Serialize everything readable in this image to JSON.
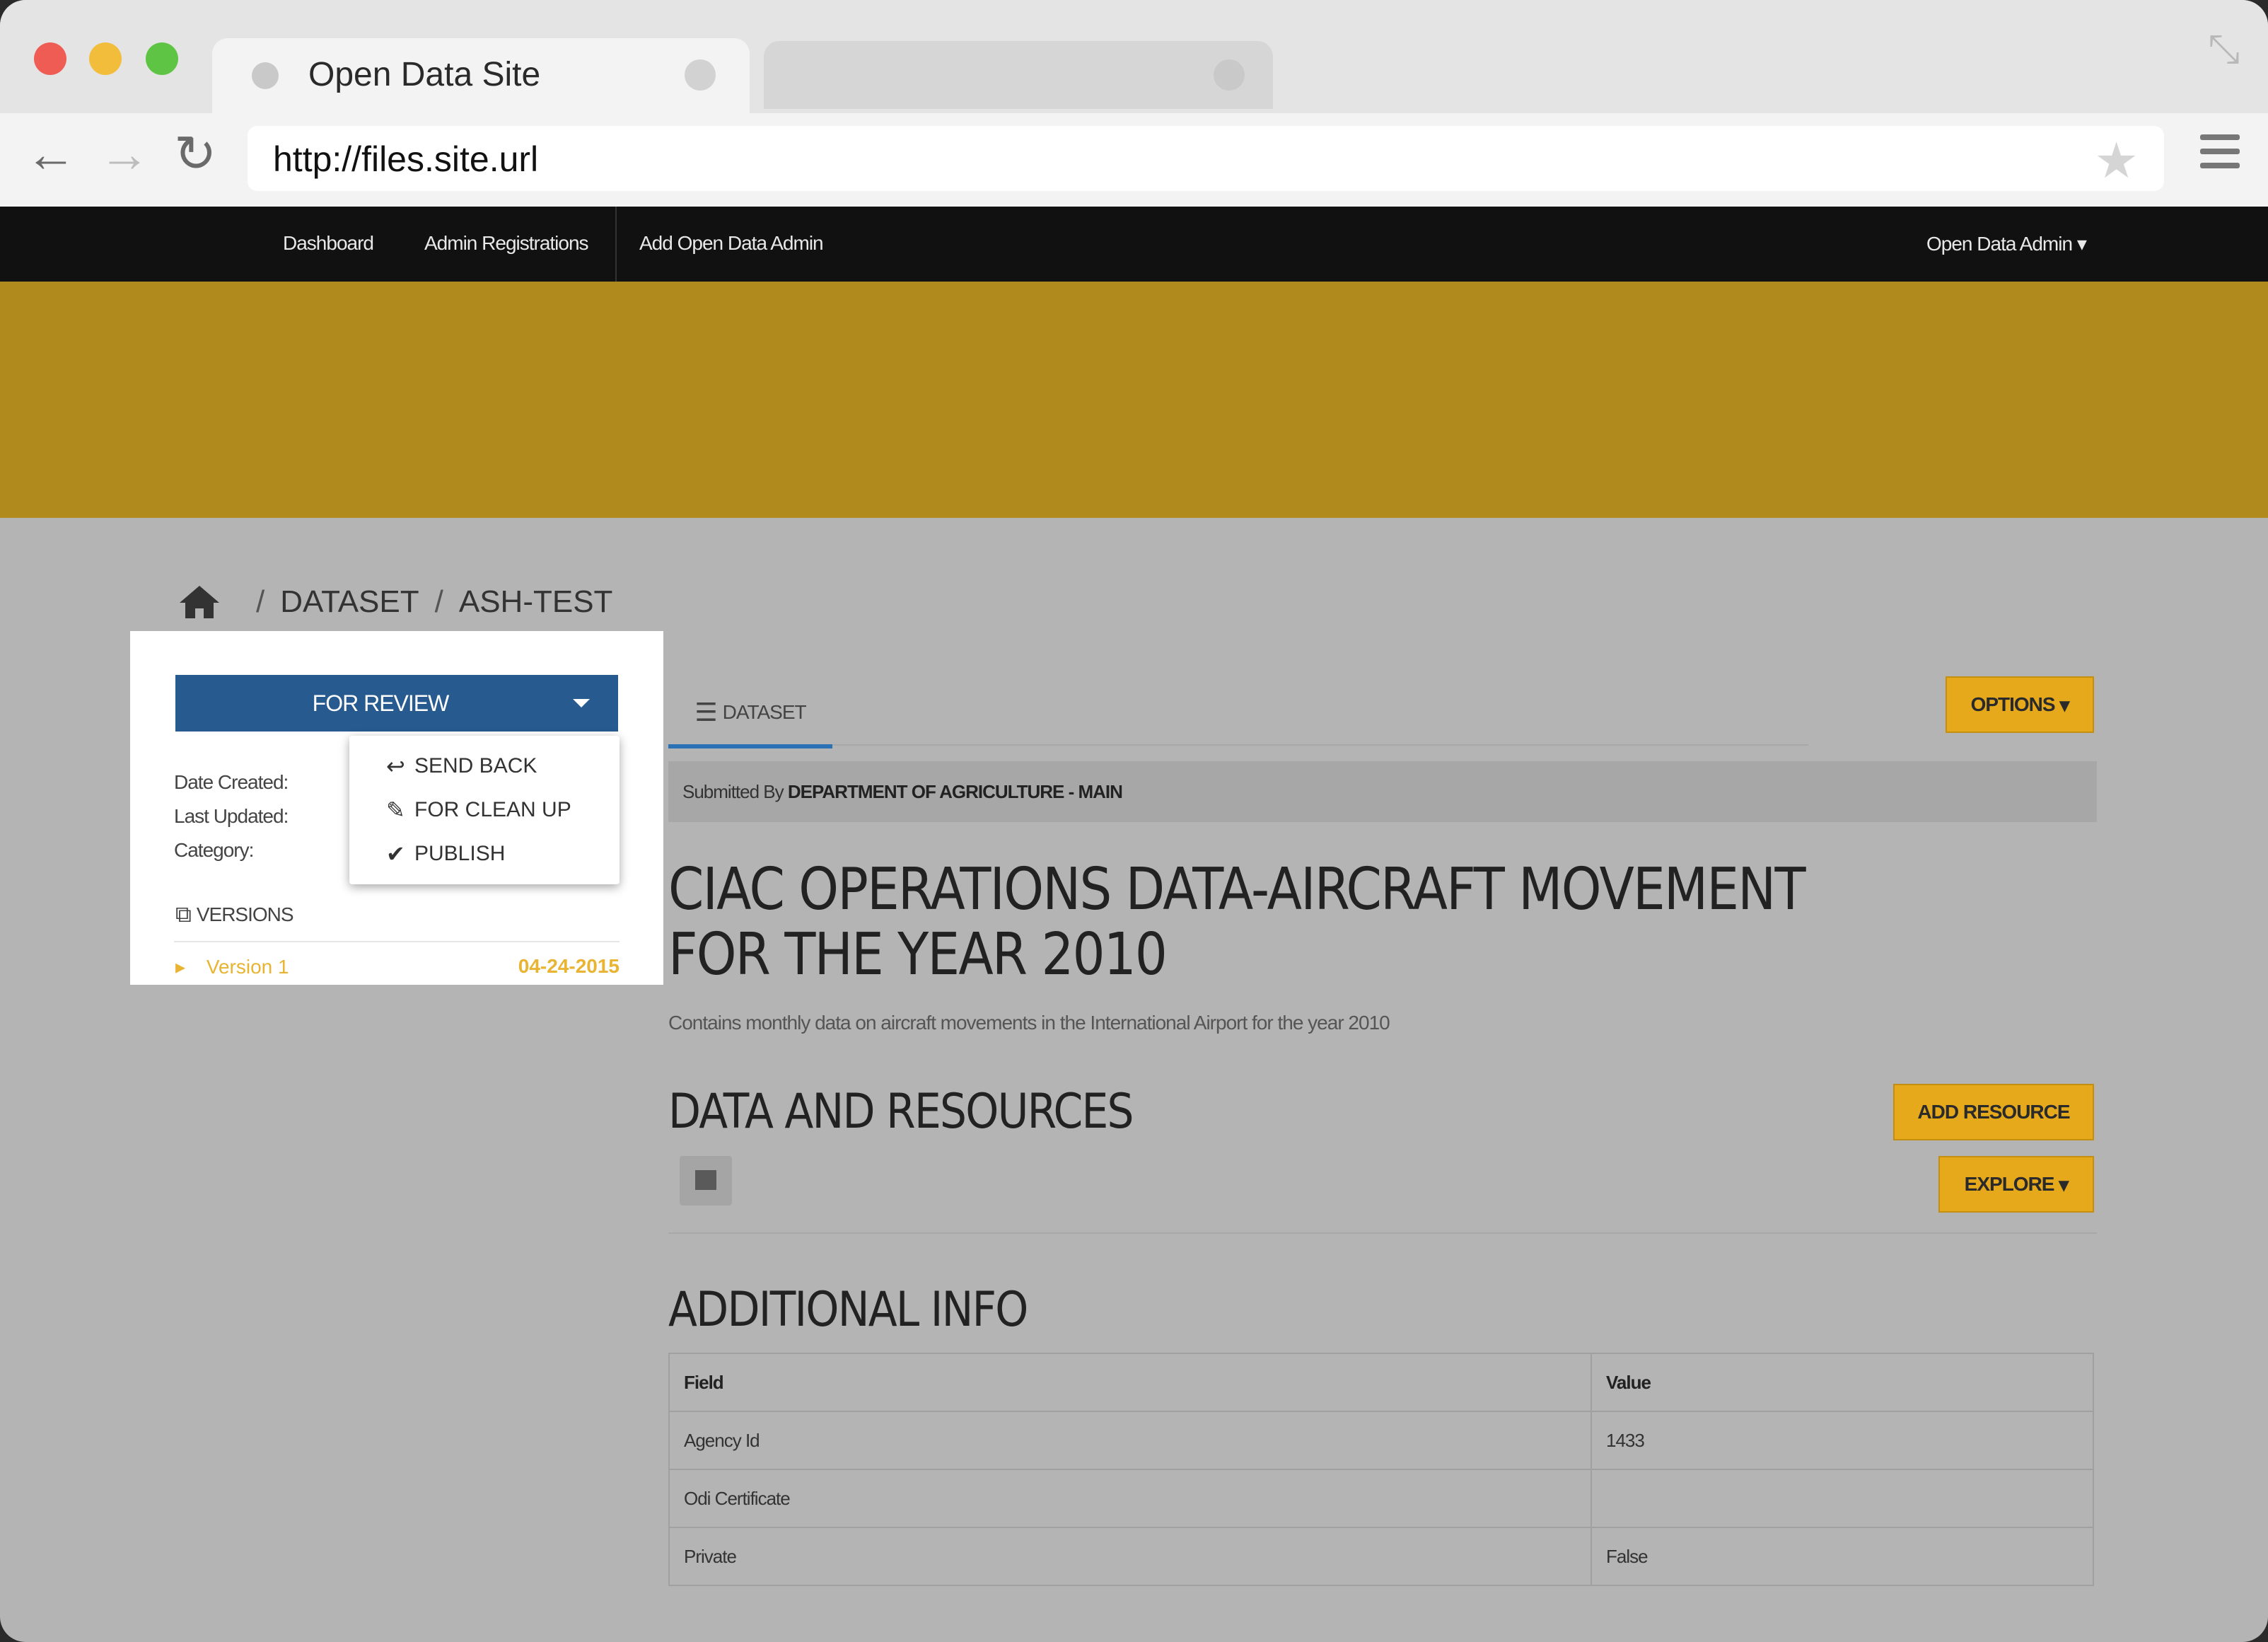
{
  "browser": {
    "tab_title": "Open Data Site",
    "url": "http://files.site.url"
  },
  "nav": {
    "items": [
      "Dashboard",
      "Admin Registrations",
      "Add Open Data Admin"
    ],
    "user_menu": "Open Data Admin"
  },
  "breadcrumb": [
    "DATASET",
    "ASH-TEST"
  ],
  "sidebar": {
    "status_button": "FOR REVIEW",
    "meta_labels": [
      "Date Created:",
      "Last Updated:",
      "Category:"
    ],
    "dropdown": [
      "SEND BACK",
      "FOR CLEAN UP",
      "PUBLISH"
    ],
    "versions_label": "VERSIONS",
    "version": {
      "label": "Version 1",
      "date": "04-24-2015"
    }
  },
  "main": {
    "tab_label": "DATASET",
    "options_button": "OPTIONS",
    "submitted_prefix": "Submitted By",
    "submitted_by": "DEPARTMENT OF AGRICULTURE - MAIN",
    "title": "CIAC OPERATIONS DATA-AIRCRAFT MOVEMENT FOR THE YEAR 2010",
    "description": "Contains monthly data on aircraft movements in the International Airport for the year 2010",
    "resources_heading": "DATA AND RESOURCES",
    "add_resource_button": "ADD RESOURCE",
    "explore_button": "EXPLORE",
    "additional_heading": "ADDITIONAL INFO",
    "table": {
      "headers": [
        "Field",
        "Value"
      ],
      "rows": [
        [
          "Agency Id",
          "1433"
        ],
        [
          "Odi Certificate",
          ""
        ],
        [
          "Private",
          "False"
        ]
      ]
    }
  },
  "colors": {
    "banner": "#b08a1c",
    "review_button": "#275a8f",
    "gold_button": "#e6a91c",
    "version_link": "#e8b431"
  }
}
